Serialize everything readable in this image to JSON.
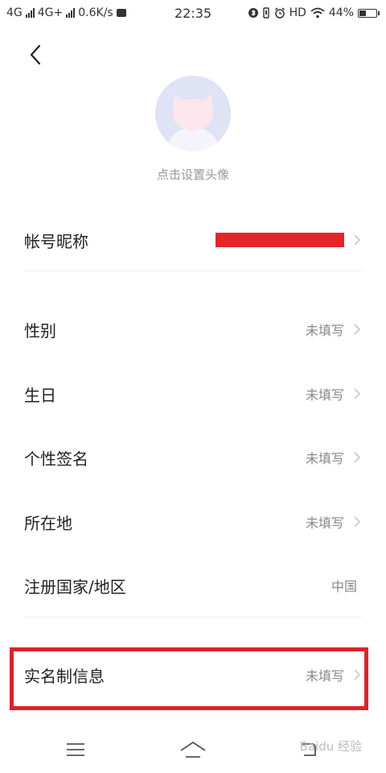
{
  "status_bar": {
    "net1": "4G",
    "net2": "4G+",
    "speed": "0.6K/s",
    "time": "22:35",
    "hd": "HD",
    "battery_text": "44%",
    "battery_level": 0.44,
    "icons": [
      "signal-icon",
      "signal-icon",
      "sim-card-icon",
      "bluetooth-icon",
      "vibrate-icon",
      "alarm-icon",
      "wifi-icon",
      "battery-icon"
    ]
  },
  "header": {
    "back_icon": "chevron-left-icon"
  },
  "avatar": {
    "hint": "点击设置头像",
    "colors": {
      "circle": "#dfe3f5",
      "face": "#fde7ec",
      "body": "#f4f5fb"
    }
  },
  "rows": {
    "nickname": {
      "label": "帐号昵称"
    },
    "gender": {
      "label": "性别",
      "value": "未填写"
    },
    "birthday": {
      "label": "生日",
      "value": "未填写"
    },
    "signature": {
      "label": "个性签名",
      "value": "未填写"
    },
    "location": {
      "label": "所在地",
      "value": "未填写"
    },
    "country": {
      "label": "注册国家/地区",
      "value": "中国"
    },
    "realname": {
      "label": "实名制信息",
      "value": "未填写"
    }
  },
  "accent_colors": {
    "highlight": "#d9242b",
    "redaction": "#e6242b"
  },
  "nav_bar": {
    "icons": [
      "menu-icon",
      "home-icon",
      "back-icon"
    ]
  },
  "watermark": "Baidu 经验"
}
